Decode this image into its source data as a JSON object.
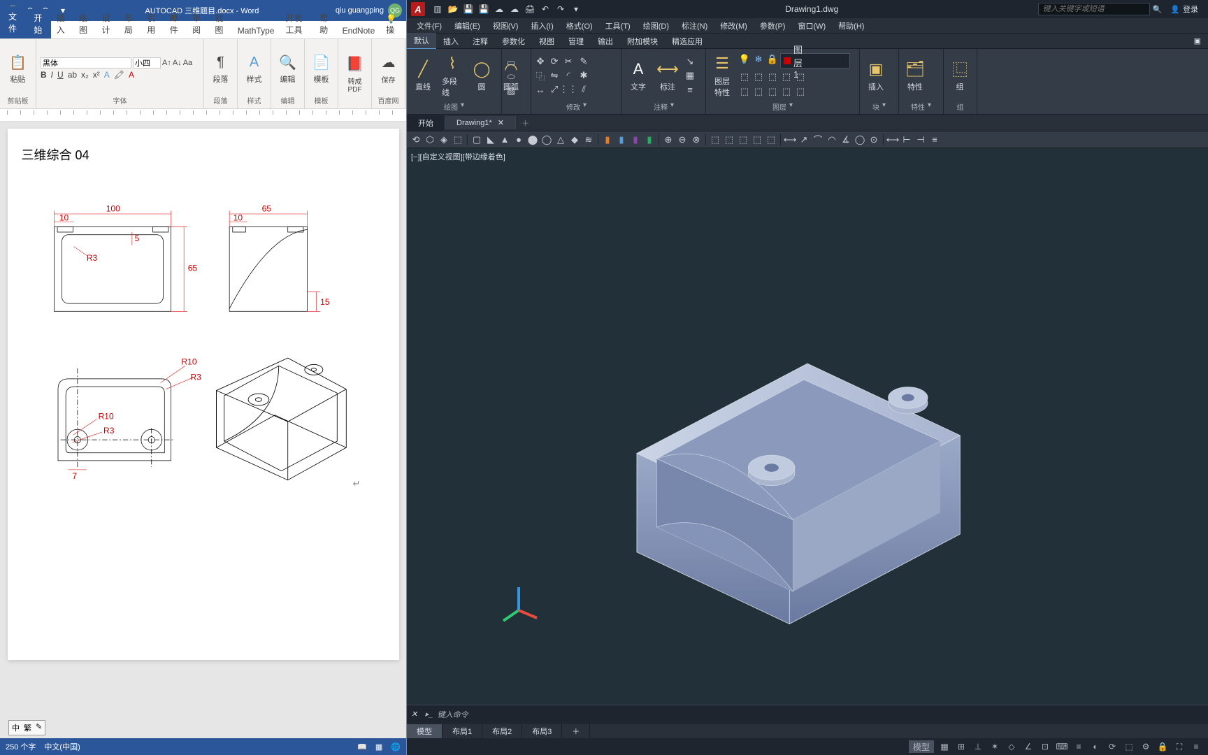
{
  "word": {
    "title_doc": "AUTOCAD 三维题目.docx",
    "title_app": "Word",
    "user": "qiu guangping",
    "user_initials": "QG",
    "tabs": [
      "文件",
      "开始",
      "插入",
      "绘图",
      "设计",
      "布局",
      "引用",
      "邮件",
      "审阅",
      "视图",
      "MathType",
      "开发工具",
      "帮助",
      "EndNote"
    ],
    "tell_me": "操",
    "font_name": "黑体",
    "font_size": "小四",
    "groups": {
      "clipboard": "剪贴板",
      "font": "字体",
      "para": "段落",
      "styles": "样式",
      "edit": "编辑",
      "template": "模板",
      "pdf": "转成PDF",
      "baidu": "百度网",
      "save": "保存"
    },
    "big": {
      "paste": "粘贴",
      "para": "段落",
      "styles": "样式",
      "edit": "编辑",
      "template": "模板",
      "pdf": "转成\nPDF",
      "baidu": "百度网",
      "save": "保存"
    },
    "doc_heading": "三维综合 04",
    "dims": {
      "d100": "100",
      "d10a": "10",
      "d10b": "10",
      "d65a": "65",
      "d65b": "65",
      "d5": "5",
      "d15": "15",
      "d7": "7",
      "r3a": "R3",
      "r3b": "R3",
      "r3c": "R3",
      "r10a": "R10",
      "r10b": "R10"
    },
    "status": {
      "words_label": "250 个字",
      "lang": "中文(中国)",
      "ime": "中"
    },
    "ime_alt": "繁"
  },
  "cad": {
    "title": "Drawing1.dwg",
    "search_ph": "键入关键字或短语",
    "login": "登录",
    "menus": [
      "文件(F)",
      "编辑(E)",
      "视图(V)",
      "插入(I)",
      "格式(O)",
      "工具(T)",
      "绘图(D)",
      "标注(N)",
      "修改(M)",
      "参数(P)",
      "窗口(W)",
      "帮助(H)"
    ],
    "ribtabs": [
      "默认",
      "插入",
      "注释",
      "参数化",
      "视图",
      "管理",
      "输出",
      "附加模块",
      "精选应用"
    ],
    "groups": {
      "draw": "绘图",
      "modify": "修改",
      "annot": "注释",
      "layer": "图层",
      "block": "块",
      "prop": "特性",
      "group": "组"
    },
    "big": {
      "line": "直线",
      "pline": "多段线",
      "circle": "圆",
      "arc": "圆弧",
      "text": "文字",
      "dim": "标注",
      "layerprop": "图层\n特性",
      "insert": "插入",
      "prop": "特性",
      "group": "组"
    },
    "layer_name": "图层1",
    "doctabs": {
      "start": "开始",
      "drawing": "Drawing1*"
    },
    "vp_label": "[−][自定义视图][带边缘着色]",
    "cmd_hint": "键入命令",
    "layouts": {
      "model": "模型",
      "l1": "布局1",
      "l2": "布局2",
      "l3": "布局3"
    },
    "status_model": "模型"
  }
}
